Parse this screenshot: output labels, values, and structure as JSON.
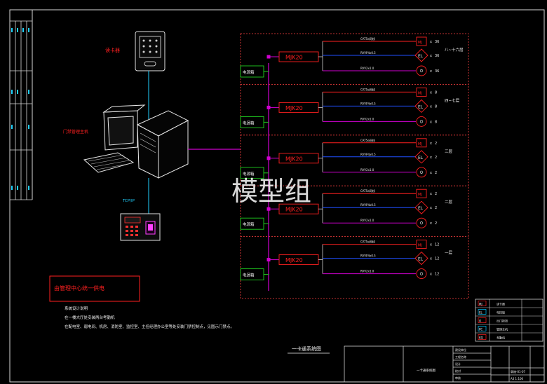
{
  "drawing": {
    "card_reader_label": "读卡器",
    "pc_label": "门禁管理主机",
    "tcpip_label": "TCP/IP",
    "power_note": "由管理中心统一供电",
    "design_notes_title": "系统设计说明",
    "design_notes": [
      "在一楼大厅处安装两台考勤机",
      "在配电室、弱电间、机房、消防室、监控室、主任经理办公室等处安装门禁控制点，见图示门禁点。"
    ],
    "watermark": "模型组",
    "diagram_title": "一卡通系统图",
    "title_block": {
      "drawing_name": "一卡通系统图",
      "drawing_number": "弱施-01-07",
      "scale": "A3 1:100",
      "row_labels": [
        "建设单位",
        "工程名称",
        "设计",
        "校对",
        "审核"
      ]
    }
  },
  "floors": [
    {
      "label": "八~十六层",
      "controller": "MJK20",
      "power_box": "电源箱",
      "counts": [
        "36",
        "36",
        "36"
      ]
    },
    {
      "label": "四~七层",
      "controller": "MJK20",
      "power_box": "电源箱",
      "counts": [
        "8",
        "8",
        "8"
      ]
    },
    {
      "label": "三层",
      "controller": "MJK20",
      "power_box": "电源箱",
      "counts": [
        "2",
        "2",
        "2"
      ]
    },
    {
      "label": "二层",
      "controller": "MJK20",
      "power_box": "电源箱",
      "counts": [
        "2",
        "2",
        "2"
      ]
    },
    {
      "label": "一层",
      "controller": "MJK20",
      "power_box": "电源箱",
      "counts": [
        "12",
        "12",
        "12"
      ]
    }
  ],
  "cable_labels": [
    "CAT5e网线",
    "RVVP4x0.5",
    "RVV2x1.0"
  ],
  "multiply_sign": "x",
  "legend_rows": [
    {
      "symbol": "MJ",
      "name": "读卡器"
    },
    {
      "symbol": "EL",
      "name": "电控锁"
    },
    {
      "symbol": "O",
      "name": "出门按钮"
    },
    {
      "symbol": "PC",
      "name": "管理主机"
    },
    {
      "symbol": "KQ",
      "name": "考勤机"
    }
  ],
  "colors": {
    "frame": "#e0e0e0",
    "red": "#ff2020",
    "magenta": "#d000d0",
    "blue": "#2050ff",
    "green": "#20d020",
    "cyan": "#00c8ff",
    "dashed": "#ff4040"
  }
}
